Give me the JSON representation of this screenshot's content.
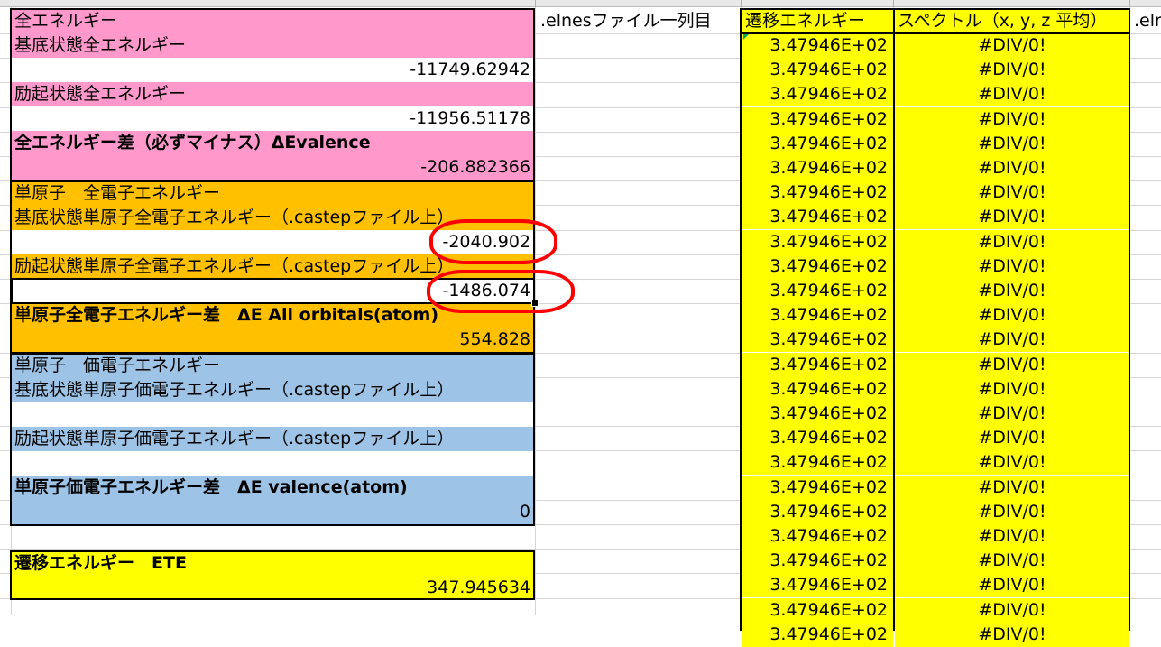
{
  "left_panel": {
    "total_energy": {
      "header": "全エネルギー",
      "ground_label": "基底状態全エネルギー",
      "ground_value": "-11749.62942",
      "excited_label": "励起状態全エネルギー",
      "excited_value": "-11956.51178",
      "diff_label": "全エネルギー差（必ずマイナス）ΔEvalence",
      "diff_value": "-206.882366"
    },
    "single_atom_all": {
      "header": "単原子　全電子エネルギー",
      "ground_label": "基底状態単原子全電子エネルギー（.castepファイル上）",
      "ground_value": "-2040.902",
      "excited_label": "励起状態単原子全電子エネルギー（.castepファイル上）",
      "excited_value": "-1486.074",
      "diff_label": "単原子全電子エネルギー差　ΔE All orbitals(atom)",
      "diff_value": "554.828"
    },
    "single_atom_valence": {
      "header": "単原子　価電子エネルギー",
      "ground_label": "基底状態単原子価電子エネルギー（.castepファイル上）",
      "ground_value": "",
      "excited_label": "励起状態単原子価電子エネルギー（.castepファイル上）",
      "excited_value": "",
      "diff_label": "単原子価電子エネルギー差　ΔE valence(atom)",
      "diff_value": "0"
    },
    "transition": {
      "label": "遷移エネルギー　ETE",
      "value": "347.945634"
    }
  },
  "columns": {
    "elnes_header": ".elnesファイル一列目",
    "transition_header": "遷移エネルギー",
    "spectrum_header": "スペクトル（x, y, z 平均）",
    "next_header": ".eln"
  },
  "table_rows": [
    {
      "transition": "3.47946E+02",
      "spectrum": "#DIV/0!"
    },
    {
      "transition": "3.47946E+02",
      "spectrum": "#DIV/0!"
    },
    {
      "transition": "3.47946E+02",
      "spectrum": "#DIV/0!"
    },
    {
      "transition": "3.47946E+02",
      "spectrum": "#DIV/0!"
    },
    {
      "transition": "3.47946E+02",
      "spectrum": "#DIV/0!"
    },
    {
      "transition": "3.47946E+02",
      "spectrum": "#DIV/0!"
    },
    {
      "transition": "3.47946E+02",
      "spectrum": "#DIV/0!"
    },
    {
      "transition": "3.47946E+02",
      "spectrum": "#DIV/0!"
    },
    {
      "transition": "3.47946E+02",
      "spectrum": "#DIV/0!"
    },
    {
      "transition": "3.47946E+02",
      "spectrum": "#DIV/0!"
    },
    {
      "transition": "3.47946E+02",
      "spectrum": "#DIV/0!"
    },
    {
      "transition": "3.47946E+02",
      "spectrum": "#DIV/0!"
    },
    {
      "transition": "3.47946E+02",
      "spectrum": "#DIV/0!"
    },
    {
      "transition": "3.47946E+02",
      "spectrum": "#DIV/0!"
    },
    {
      "transition": "3.47946E+02",
      "spectrum": "#DIV/0!"
    },
    {
      "transition": "3.47946E+02",
      "spectrum": "#DIV/0!"
    },
    {
      "transition": "3.47946E+02",
      "spectrum": "#DIV/0!"
    },
    {
      "transition": "3.47946E+02",
      "spectrum": "#DIV/0!"
    },
    {
      "transition": "3.47946E+02",
      "spectrum": "#DIV/0!"
    },
    {
      "transition": "3.47946E+02",
      "spectrum": "#DIV/0!"
    },
    {
      "transition": "3.47946E+02",
      "spectrum": "#DIV/0!"
    },
    {
      "transition": "3.47946E+02",
      "spectrum": "#DIV/0!"
    },
    {
      "transition": "3.47946E+02",
      "spectrum": "#DIV/0!"
    },
    {
      "transition": "3.47946E+02",
      "spectrum": "#DIV/0!"
    },
    {
      "transition": "3.47946E+02",
      "spectrum": "#DIV/0!"
    }
  ],
  "colors": {
    "pink": "#ff99cc",
    "orange": "#ffc000",
    "blue": "#9dc3e6",
    "yellow": "#ffff00",
    "annotation": "#ff0000",
    "error_indicator": "#00a651"
  }
}
